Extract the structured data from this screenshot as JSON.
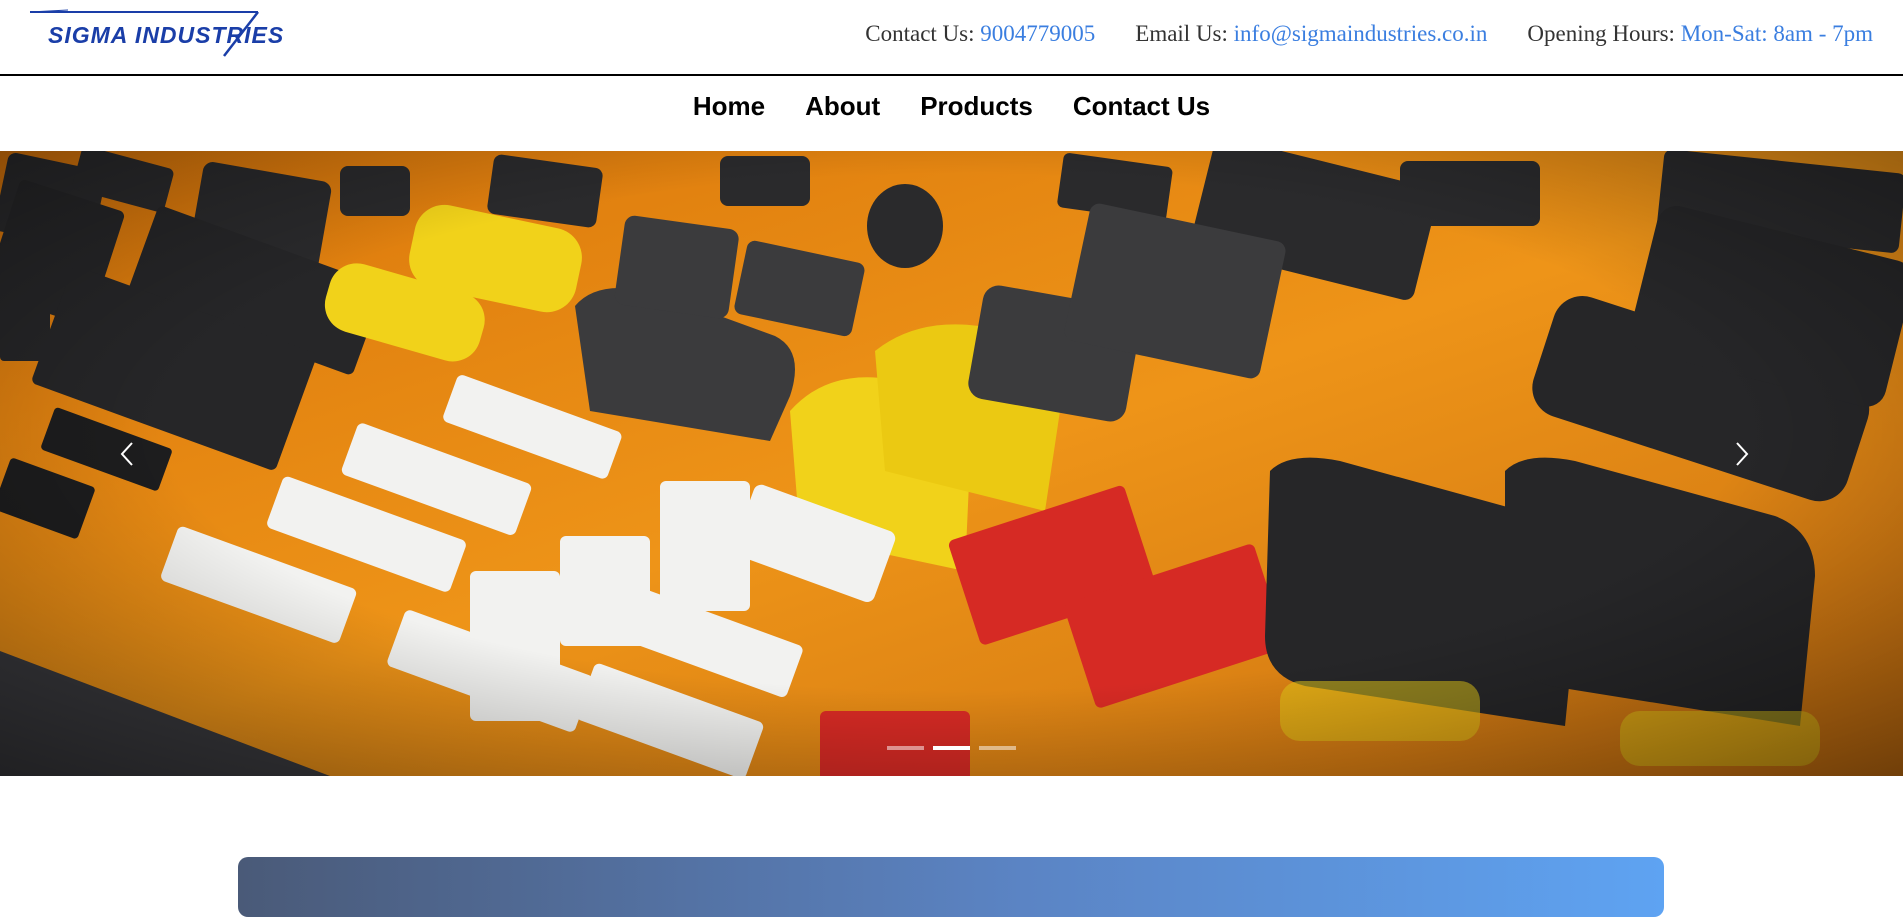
{
  "brand": {
    "name": "SIGMA INDUSTRIES",
    "primary_color": "#1a3ea8",
    "link_color": "#3a7ee0"
  },
  "contact": {
    "phone_label": "Contact Us:",
    "phone_value": "9004779005",
    "email_label": "Email Us:",
    "email_value": "info@sigmaindustries.co.in",
    "hours_label": "Opening Hours:",
    "hours_value": "Mon-Sat: 8am - 7pm"
  },
  "nav": {
    "items": [
      {
        "label": "Home"
      },
      {
        "label": "About"
      },
      {
        "label": "Products"
      },
      {
        "label": "Contact Us"
      }
    ]
  },
  "carousel": {
    "slide_count": 3,
    "active_index": 1,
    "prev_icon": "chevron-left-icon",
    "next_icon": "chevron-right-icon",
    "image_subject": "plastic connector parts on orange surface",
    "colors": {
      "background": "#e58a12",
      "dark_parts": "#2b2b2b",
      "yellow_parts": "#f2d21a",
      "red_parts": "#d82a25",
      "white_parts": "#f2f2f2"
    }
  },
  "promo_panel": {
    "gradient_start": "#4a5a78",
    "gradient_end": "#5ea3f2"
  }
}
